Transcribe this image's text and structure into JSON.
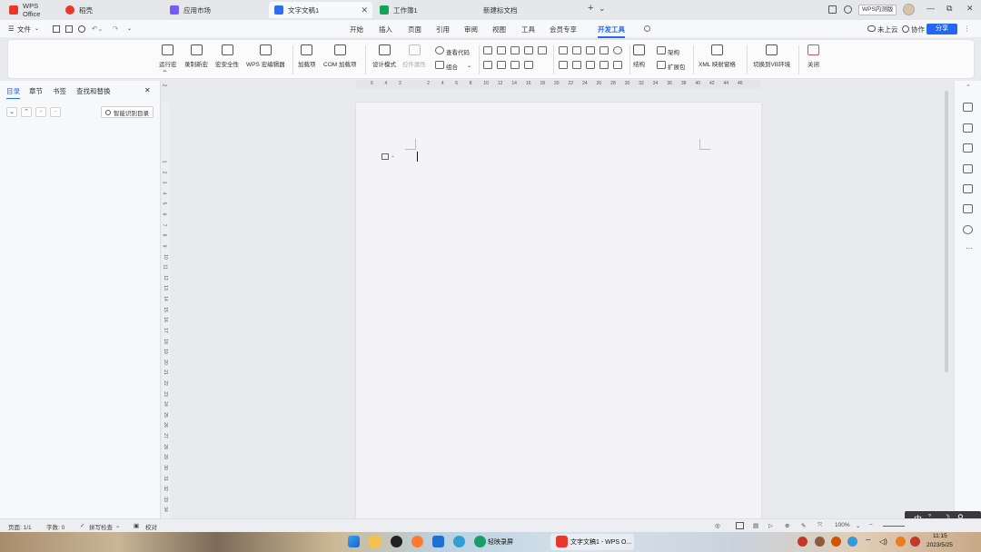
{
  "titlebar": {
    "tabs": [
      {
        "label": "WPS Office",
        "icon": "wps-logo-icon",
        "color": "#e8372c"
      },
      {
        "label": "稻壳",
        "icon": "docer-icon",
        "color": "#e8372c"
      },
      {
        "label": "应用市场",
        "icon": "app-market-icon",
        "color": "#7a5af5"
      },
      {
        "label": "文字文稿1",
        "icon": "writer-doc-icon",
        "color": "#2b6ef2"
      },
      {
        "label": "工作簿1",
        "icon": "spreadsheet-icon",
        "color": "#14a35b"
      },
      {
        "label": "新建标文档",
        "icon": "",
        "color": ""
      }
    ],
    "new_tab": "+",
    "tab_dropdown": "⌄",
    "badge": "WPS内测版",
    "window_controls": [
      "—",
      "⧉",
      "✕"
    ]
  },
  "menubar": {
    "file_label": "文件",
    "items": [
      "开始",
      "插入",
      "页面",
      "引用",
      "审阅",
      "视图",
      "工具",
      "会员专享",
      "开发工具"
    ],
    "active": "开发工具",
    "right": {
      "cloud": "未上云",
      "collab": "协作",
      "share": "分享"
    }
  },
  "ribbon": {
    "group1": [
      "运行宏",
      "录制新宏",
      "宏安全性",
      "WPS 宏编辑器"
    ],
    "group2": [
      "加载项",
      "COM 加载项"
    ],
    "group3": {
      "design_mode": "设计模式",
      "control_props": "控件属性",
      "view_code": "查看代码",
      "combine": "组合"
    },
    "group5": {
      "structure": "结构",
      "schema": "架构",
      "expansion": "扩展包",
      "xml_mapping": "XML 映射窗格"
    },
    "group6": [
      "切换到VB环境"
    ],
    "close": "关闭"
  },
  "left_panel": {
    "tabs": [
      "目录",
      "章节",
      "书签",
      "查找和替换"
    ],
    "active_tab": "目录",
    "smart_toc_button": "智能识别目录",
    "close": "✕"
  },
  "ruler": {
    "h_ticks": [
      "6",
      "4",
      "2",
      "",
      "2",
      "4",
      "6",
      "8",
      "10",
      "12",
      "14",
      "16",
      "18",
      "20",
      "22",
      "24",
      "26",
      "28",
      "30",
      "32",
      "34",
      "36",
      "38",
      "40",
      "42",
      "44",
      "46"
    ],
    "v_ticks_top": [
      "4",
      "2"
    ],
    "v_ticks": [
      "1",
      "2",
      "3",
      "4",
      "5",
      "6",
      "7",
      "8",
      "9",
      "10",
      "11",
      "12",
      "13",
      "14",
      "15",
      "16",
      "17",
      "18",
      "19",
      "20",
      "21",
      "22",
      "23",
      "24",
      "25",
      "26",
      "27",
      "28",
      "29",
      "30",
      "31",
      "32",
      "33",
      "34"
    ]
  },
  "statusbar": {
    "page": "页面: 1/1",
    "words": "字数: 0",
    "spellcheck": "拼写检查",
    "proofread": "校对",
    "zoom": "100%"
  },
  "ime": {
    "lang": "中",
    "punct": "°,"
  },
  "taskbar": {
    "apps": [
      {
        "label": "轻映录屏",
        "color": "#1a9c6b"
      },
      {
        "label": "文字文稿1 - WPS O...",
        "color": "#e8372c"
      }
    ],
    "time": "11:15",
    "date": "2023/5/25"
  }
}
